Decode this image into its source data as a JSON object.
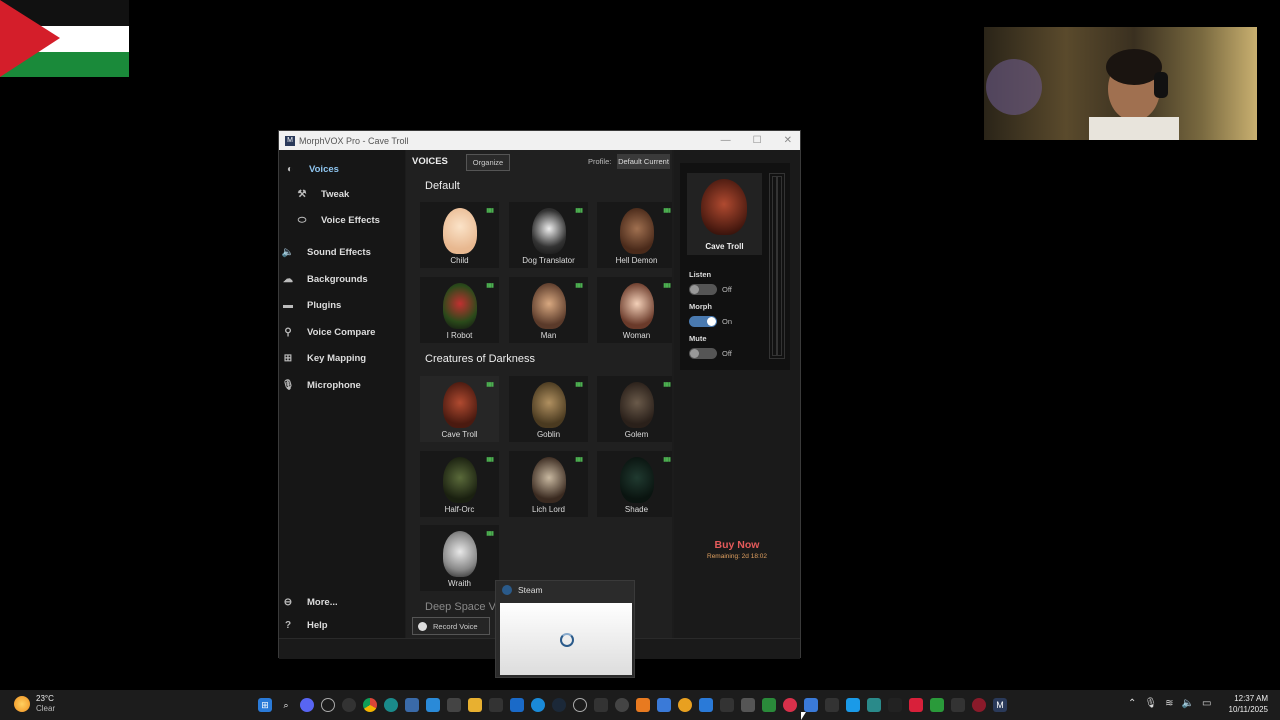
{
  "window": {
    "title": "MorphVOX Pro - Cave Troll",
    "controls": {
      "minimize": "—",
      "maximize": "☐",
      "close": "✕"
    }
  },
  "sidebar": {
    "items": [
      {
        "label": "Voices",
        "icon": "voices-icon",
        "glyph": "◐"
      },
      {
        "label": "Tweak",
        "icon": "tweak-icon",
        "glyph": "⚒"
      },
      {
        "label": "Voice Effects",
        "icon": "voice-effects-icon",
        "glyph": "⬭"
      },
      {
        "label": "Sound Effects",
        "icon": "sound-effects-icon",
        "glyph": "🔈"
      },
      {
        "label": "Backgrounds",
        "icon": "backgrounds-icon",
        "glyph": "☁"
      },
      {
        "label": "Plugins",
        "icon": "plugins-icon",
        "glyph": "▬"
      },
      {
        "label": "Voice Compare",
        "icon": "voice-compare-icon",
        "glyph": "⚲"
      },
      {
        "label": "Key Mapping",
        "icon": "key-mapping-icon",
        "glyph": "⊞"
      },
      {
        "label": "Microphone",
        "icon": "microphone-icon",
        "glyph": "🎙"
      },
      {
        "label": "More...",
        "icon": "more-icon",
        "glyph": "⊖"
      },
      {
        "label": "Help",
        "icon": "help-icon",
        "glyph": "?"
      }
    ]
  },
  "voices_panel": {
    "heading": "VOICES",
    "organize_label": "Organize",
    "profile_label": "Profile:",
    "profile_value": "Default Current",
    "sections": [
      {
        "title": "Default",
        "voices": [
          "Child",
          "Dog Translator",
          "Hell Demon",
          "I Robot",
          "Man",
          "Woman"
        ]
      },
      {
        "title": "Creatures of Darkness",
        "voices": [
          "Cave Troll",
          "Goblin",
          "Golem",
          "Half-Orc",
          "Lich Lord",
          "Shade",
          "Wraith"
        ]
      },
      {
        "title": "Deep Space V",
        "voices": []
      }
    ],
    "selected_voice": "Cave Troll",
    "record_label": "Record Voice",
    "signal_glyph": "▮▮▮"
  },
  "current_voice": {
    "name": "Cave Troll",
    "listen": {
      "label": "Listen",
      "state": "Off"
    },
    "morph": {
      "label": "Morph",
      "state": "On"
    },
    "mute": {
      "label": "Mute",
      "state": "Off"
    }
  },
  "promo": {
    "buy_label": "Buy Now",
    "remaining": "Remaining: 2d 18:02"
  },
  "steam_popup": {
    "title": "Steam"
  },
  "taskbar": {
    "weather_temp": "23°C",
    "weather_desc": "Clear",
    "time": "12:37 AM",
    "date": "10/11/2025",
    "apps": [
      "windows",
      "search",
      "discord",
      "obs",
      "chrome",
      "x",
      "edge",
      "files",
      "store",
      "steam",
      "epic",
      "vscode",
      "music",
      "bin",
      "app1",
      "app2",
      "app3",
      "app4",
      "app5",
      "app6",
      "app7",
      "app8",
      "app9",
      "app10",
      "app11",
      "app12",
      "app13",
      "app14",
      "app15",
      "morphvox"
    ]
  },
  "colors": {
    "accent": "#4a7ab0",
    "buy": "#e45a5a",
    "signal": "#4caf50"
  }
}
